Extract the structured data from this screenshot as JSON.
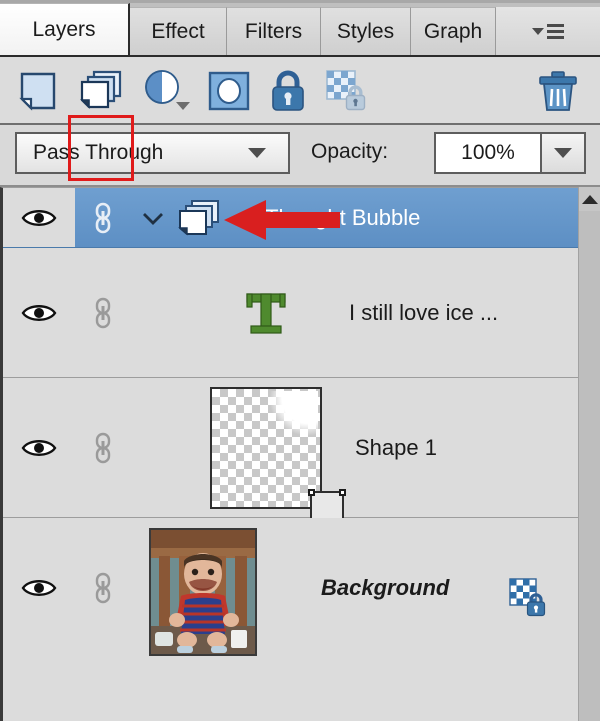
{
  "panel": {
    "title": "Layers",
    "tabs": [
      {
        "label": "Layers",
        "active": true
      },
      {
        "label": "Effect",
        "active": false
      },
      {
        "label": "Filters",
        "active": false
      },
      {
        "label": "Styles",
        "active": false
      },
      {
        "label": "Graph",
        "active": false
      }
    ],
    "tab_menu_icon": "panel-menu-icon"
  },
  "toolbar": {
    "items": [
      {
        "name": "new-layer-icon",
        "tooltip": "New Layer"
      },
      {
        "name": "duplicate-layer-icon",
        "tooltip": "Duplicate Layer",
        "highlighted": true
      },
      {
        "name": "adjustment-layer-icon",
        "tooltip": "Adjustment Layer"
      },
      {
        "name": "layer-mask-icon",
        "tooltip": "Layer Mask"
      },
      {
        "name": "lock-layer-icon",
        "tooltip": "Lock Layer"
      },
      {
        "name": "lock-transparency-icon",
        "tooltip": "Lock Transparent Pixels"
      },
      {
        "name": "delete-layer-icon",
        "tooltip": "Delete Layer"
      }
    ],
    "highlight_color": "#e01b1b"
  },
  "blend": {
    "mode": "Pass Through",
    "opacity_label": "Opacity:",
    "opacity_value": "100%"
  },
  "layers": [
    {
      "name": "Thought Bubble",
      "type": "group",
      "selected": true,
      "visible": true,
      "linked": true,
      "expanded": false,
      "thumb": "group-folder-icon",
      "badge": null,
      "italic": false
    },
    {
      "name": "I still love ice ...",
      "type": "text",
      "selected": false,
      "visible": true,
      "linked": true,
      "thumb": "text-layer-icon",
      "badge": null,
      "italic": false
    },
    {
      "name": "Shape 1",
      "type": "shape",
      "selected": false,
      "visible": true,
      "linked": true,
      "thumb": "transparent-checker-thumbnail",
      "badge": "vector-mask-badge",
      "italic": false
    },
    {
      "name": "Background",
      "type": "image",
      "selected": false,
      "visible": true,
      "linked": true,
      "thumb": "photo-thumbnail",
      "badge": "locked-badge",
      "italic": true
    }
  ],
  "annotation": {
    "type": "red-arrow",
    "direction": "left",
    "color": "#d91f1f",
    "target": "Thought Bubble group icon"
  },
  "scrollbar": {
    "up_arrow": "scroll-up-icon"
  },
  "colors": {
    "selection_blue": "#5d8fc4",
    "panel_bg": "#d9d9d9",
    "row_bg": "#dcdcdc",
    "icon_blue": "#3c6ea5",
    "text_icon_green": "#4f8a2e"
  }
}
